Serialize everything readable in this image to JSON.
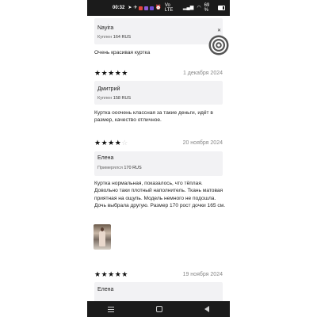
{
  "status_bar": {
    "time": "00:32",
    "network": "Vo LTE",
    "battery": "69 %"
  },
  "reviews": [
    {
      "author": "Nayira",
      "bought_label": "Куплен",
      "bought_value": "164 RUS",
      "text": "Очень красивая куртка",
      "rating": 5,
      "date": "",
      "has_photo": false
    },
    {
      "author": "Дмитрий",
      "bought_label": "Куплен",
      "bought_value": "158 RUS",
      "text": "Куртка ооочень классная за такие деньги, идёт в размер, качество отличное.",
      "rating": 5,
      "date": "1 декабря 2024",
      "has_photo": false
    },
    {
      "author": "Елена",
      "bought_label": "Примерялся",
      "bought_value": "170 RUS",
      "text": "Куртка нормальная, показалось, что тёплая. Довольно таки плотный наполнитель. Ткань матовая приятная на ощупь. Модель немного не подошла. Дочь выбрала другую. Размер 170 рост дочки 165 см.",
      "rating": 4,
      "date": "20 ноября 2024",
      "has_photo": true
    },
    {
      "author": "Елена",
      "bought_label": "",
      "bought_value": "",
      "text": "",
      "rating": 5,
      "date": "19 ноября 2024",
      "has_photo": false
    }
  ],
  "icons": {
    "target": "concentric-target-icon",
    "close": "close-icon",
    "star": "star-icon"
  },
  "colors": {
    "meta_bg": "#f2f2f4",
    "bars": "#1b1b1b",
    "star": "#111111",
    "star_empty": "#cfcfcf"
  }
}
